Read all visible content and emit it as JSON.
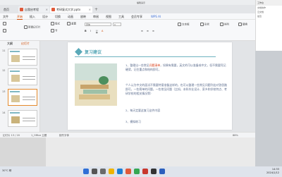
{
  "window": {
    "title": "编辑演示"
  },
  "tabs": [
    {
      "label": "首页"
    },
    {
      "label": "自我启考程"
    },
    {
      "label": "考研复试大学.pptx"
    }
  ],
  "right_panel": {
    "title": "工作台",
    "lines": [
      "文档协作",
      "云文档",
      "最近"
    ]
  },
  "menu": [
    "文件",
    "开始",
    "插入",
    "设计",
    "切换",
    "动画",
    "放映",
    "审阅",
    "视图",
    "工具",
    "会员专享",
    "WPS AI"
  ],
  "menu_active_index": 1,
  "ribbon": {
    "new_slide": "新建幻灯片",
    "layout": "版式",
    "section": "节",
    "reset": "重置",
    "font_name": "宋体",
    "font_size": "0",
    "text_box": "文本框",
    "shapes": "形状",
    "arrange": "排列",
    "replace": "替换"
  },
  "sidebar": {
    "tabs": [
      "大纲",
      "幻灯片"
    ],
    "active_tab": 1,
    "slides": [
      {
        "num": "11"
      },
      {
        "num": "12"
      },
      {
        "num": "13"
      },
      {
        "num": "14"
      }
    ]
  },
  "slide": {
    "title": "复习建议",
    "para1_pre": "1、整理出一些常见问题清单，如果有需要，英文的可以准备成中文，但不需要死记硬背，记住重点和结构即可。",
    "para1_hl": "问题清单",
    "para2": "个人认为中文的面试不需要特意准备这样的，也可以整理一些常见问题列出对答思路即可，一些简单的问题，一些常见问题（比如，本科毕业设计、家乡和学校特点、考研学校的相关情况等）",
    "para3": "2、每天定要这复习这件内容",
    "para4": "3、模拟练习"
  },
  "status": {
    "slide_pos": "幻灯片 13 / 20",
    "theme": "1_Office 主题",
    "missing": "缺失字体",
    "zoom": "88%"
  },
  "taskbar": {
    "weather": "30°C 晴",
    "time": "14:33",
    "date": "2024/1/12"
  }
}
